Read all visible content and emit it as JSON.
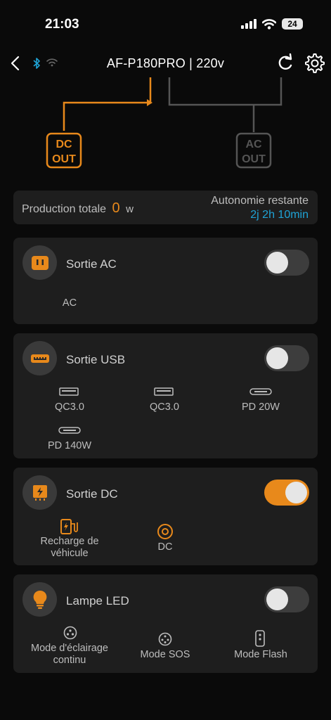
{
  "status_bar": {
    "time": "21:03",
    "battery": "24"
  },
  "nav": {
    "title": "AF-P180PRO | 220v"
  },
  "flow": {
    "dc_out": [
      "DC",
      "OUT"
    ],
    "ac_out": [
      "AC",
      "OUT"
    ]
  },
  "production": {
    "label": "Production totale",
    "value": "0",
    "unit": "w",
    "autonomy_label": "Autonomie restante",
    "autonomy_value": "2j 2h 10min"
  },
  "sections": {
    "ac": {
      "title": "Sortie AC",
      "on": false,
      "ports": [
        "AC"
      ]
    },
    "usb": {
      "title": "Sortie USB",
      "on": false,
      "ports": [
        "QC3.0",
        "QC3.0",
        "PD 20W",
        "PD 140W"
      ]
    },
    "dc": {
      "title": "Sortie DC",
      "on": true,
      "ports": [
        "Recharge de véhicule",
        "DC"
      ]
    },
    "led": {
      "title": "Lampe LED",
      "on": false,
      "ports": [
        "Mode d'éclairage continu",
        "Mode SOS",
        "Mode Flash"
      ]
    }
  },
  "colors": {
    "accent": "#e8891b",
    "link_blue": "#1fa3d6",
    "card": "#1e1e1e",
    "background": "#0a0a0a"
  }
}
